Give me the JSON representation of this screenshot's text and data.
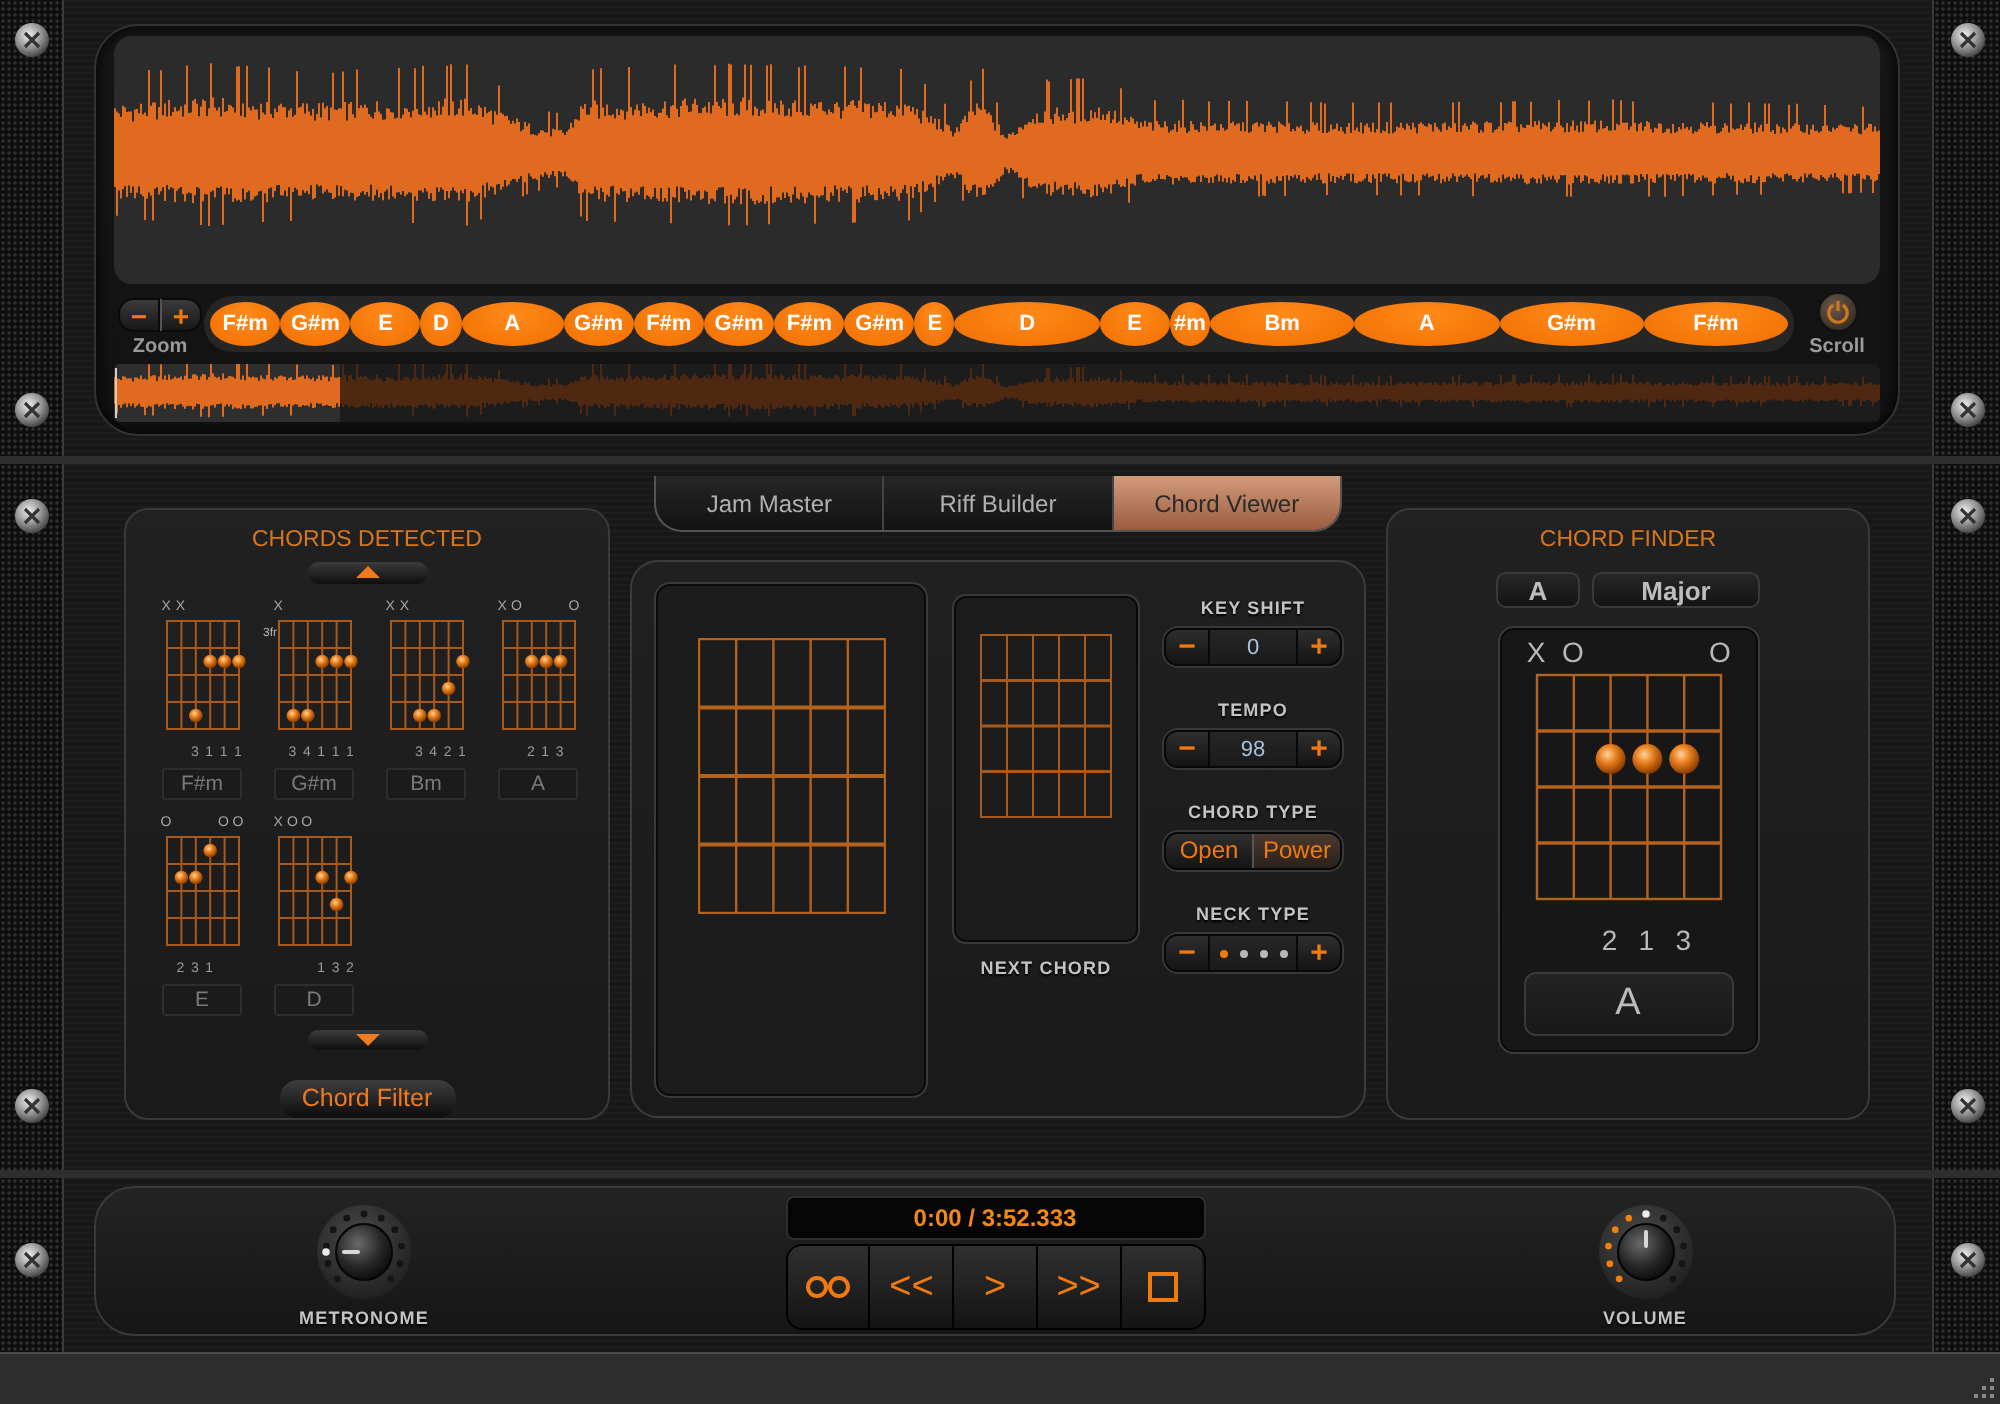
{
  "waveform_panel": {
    "zoom": {
      "decrement": "−",
      "increment": "+",
      "label": "Zoom"
    },
    "chord_lane": [
      {
        "label": "F#m",
        "kind": "small"
      },
      {
        "label": "G#m",
        "kind": "small"
      },
      {
        "label": "E",
        "kind": "small"
      },
      {
        "label": "D",
        "kind": "tiny"
      },
      {
        "label": "A",
        "kind": "medium"
      },
      {
        "label": "G#m",
        "kind": "small"
      },
      {
        "label": "F#m",
        "kind": "small"
      },
      {
        "label": "G#m",
        "kind": "small"
      },
      {
        "label": "F#m",
        "kind": "small"
      },
      {
        "label": "G#m",
        "kind": "small"
      },
      {
        "label": "E",
        "kind": "tiny"
      },
      {
        "label": "D",
        "kind": "large"
      },
      {
        "label": "E",
        "kind": "small"
      },
      {
        "label": "#m",
        "kind": "tiny"
      },
      {
        "label": "Bm",
        "kind": "large"
      },
      {
        "label": "A",
        "kind": "large"
      },
      {
        "label": "G#m",
        "kind": "large"
      },
      {
        "label": "F#m",
        "kind": "large"
      }
    ],
    "scroll": {
      "label": "Scroll"
    }
  },
  "chords_detected": {
    "title": "CHORDS DETECTED",
    "chords": [
      {
        "name": "F#m",
        "strings": [
          {
            "marker": "X"
          },
          {
            "marker": "X"
          },
          {
            "kind": "fret4",
            "finger": "3"
          },
          {
            "kind": "fret2",
            "finger": "1"
          },
          {
            "kind": "fret2",
            "finger": "1"
          },
          {
            "kind": "fret2",
            "finger": "1"
          }
        ]
      },
      {
        "name": "G#m",
        "position": "3fr",
        "strings": [
          {
            "marker": "X"
          },
          {
            "kind": "fret4",
            "finger": "3"
          },
          {
            "kind": "fret4",
            "finger": "4"
          },
          {
            "kind": "fret2",
            "finger": "1"
          },
          {
            "kind": "fret2",
            "finger": "1"
          },
          {
            "kind": "fret2",
            "finger": "1"
          }
        ]
      },
      {
        "name": "Bm",
        "strings": [
          {
            "marker": "X"
          },
          {
            "marker": "X"
          },
          {
            "kind": "fret4",
            "finger": "3"
          },
          {
            "kind": "fret4",
            "finger": "4"
          },
          {
            "kind": "fret3",
            "finger": "2"
          },
          {
            "kind": "fret2",
            "finger": "1"
          }
        ]
      },
      {
        "name": "A",
        "strings": [
          {
            "marker": "X"
          },
          {
            "marker": "O"
          },
          {
            "kind": "fret2",
            "finger": "2"
          },
          {
            "kind": "fret2",
            "finger": "1"
          },
          {
            "kind": "fret2",
            "finger": "3"
          },
          {
            "marker": "O"
          }
        ]
      },
      {
        "name": "E",
        "strings": [
          {
            "marker": "O"
          },
          {
            "kind": "fret2",
            "finger": "2"
          },
          {
            "kind": "fret2",
            "finger": "3"
          },
          {
            "kind": "fret1",
            "finger": "1"
          },
          {
            "marker": "O"
          },
          {
            "marker": "O"
          }
        ]
      },
      {
        "name": "D",
        "strings": [
          {
            "marker": "X"
          },
          {
            "marker": "O"
          },
          {
            "marker": "O"
          },
          {
            "kind": "fret2",
            "finger": "1"
          },
          {
            "kind": "fret3",
            "finger": "3"
          },
          {
            "kind": "fret2",
            "finger": "2"
          }
        ]
      }
    ],
    "filter_button": "Chord Filter"
  },
  "tabs": [
    {
      "label": "Jam Master",
      "selected": false
    },
    {
      "label": "Riff Builder",
      "selected": false
    },
    {
      "label": "Chord Viewer",
      "selected": true
    }
  ],
  "chord_viewer": {
    "next_chord_label": "NEXT CHORD",
    "key_shift": {
      "label": "KEY SHIFT",
      "decrement": "−",
      "value": "0",
      "increment": "+"
    },
    "tempo": {
      "label": "TEMPO",
      "decrement": "−",
      "value": "98",
      "increment": "+"
    },
    "chord_type": {
      "label": "CHORD TYPE",
      "options": [
        {
          "label": "Open",
          "selected": false
        },
        {
          "label": "Power",
          "selected": true
        }
      ]
    },
    "neck_type": {
      "label": "NECK TYPE",
      "decrement": "−",
      "increment": "+",
      "options": [
        {
          "selected": true
        },
        {
          "selected": false
        },
        {
          "selected": false
        },
        {
          "selected": false
        }
      ]
    }
  },
  "chord_finder": {
    "title": "CHORD FINDER",
    "root": "A",
    "quality": "Major",
    "chord": {
      "name": "A",
      "strings": [
        {
          "marker": "X"
        },
        {
          "marker": "O"
        },
        {
          "kind": "fret2",
          "finger": "2"
        },
        {
          "kind": "fret2",
          "finger": "1"
        },
        {
          "kind": "fret2",
          "finger": "3"
        },
        {
          "marker": "O"
        }
      ]
    }
  },
  "transport": {
    "metronome": {
      "label": "METRONOME",
      "level": 0
    },
    "time": "0:00 / 3:52.333",
    "buttons": [
      {
        "kind": "loop"
      },
      {
        "kind": "rewind",
        "label": "<<"
      },
      {
        "kind": "play",
        "label": ">"
      },
      {
        "kind": "forward",
        "label": ">>"
      },
      {
        "kind": "stop"
      }
    ],
    "volume": {
      "label": "VOLUME",
      "level": 0.5
    }
  }
}
